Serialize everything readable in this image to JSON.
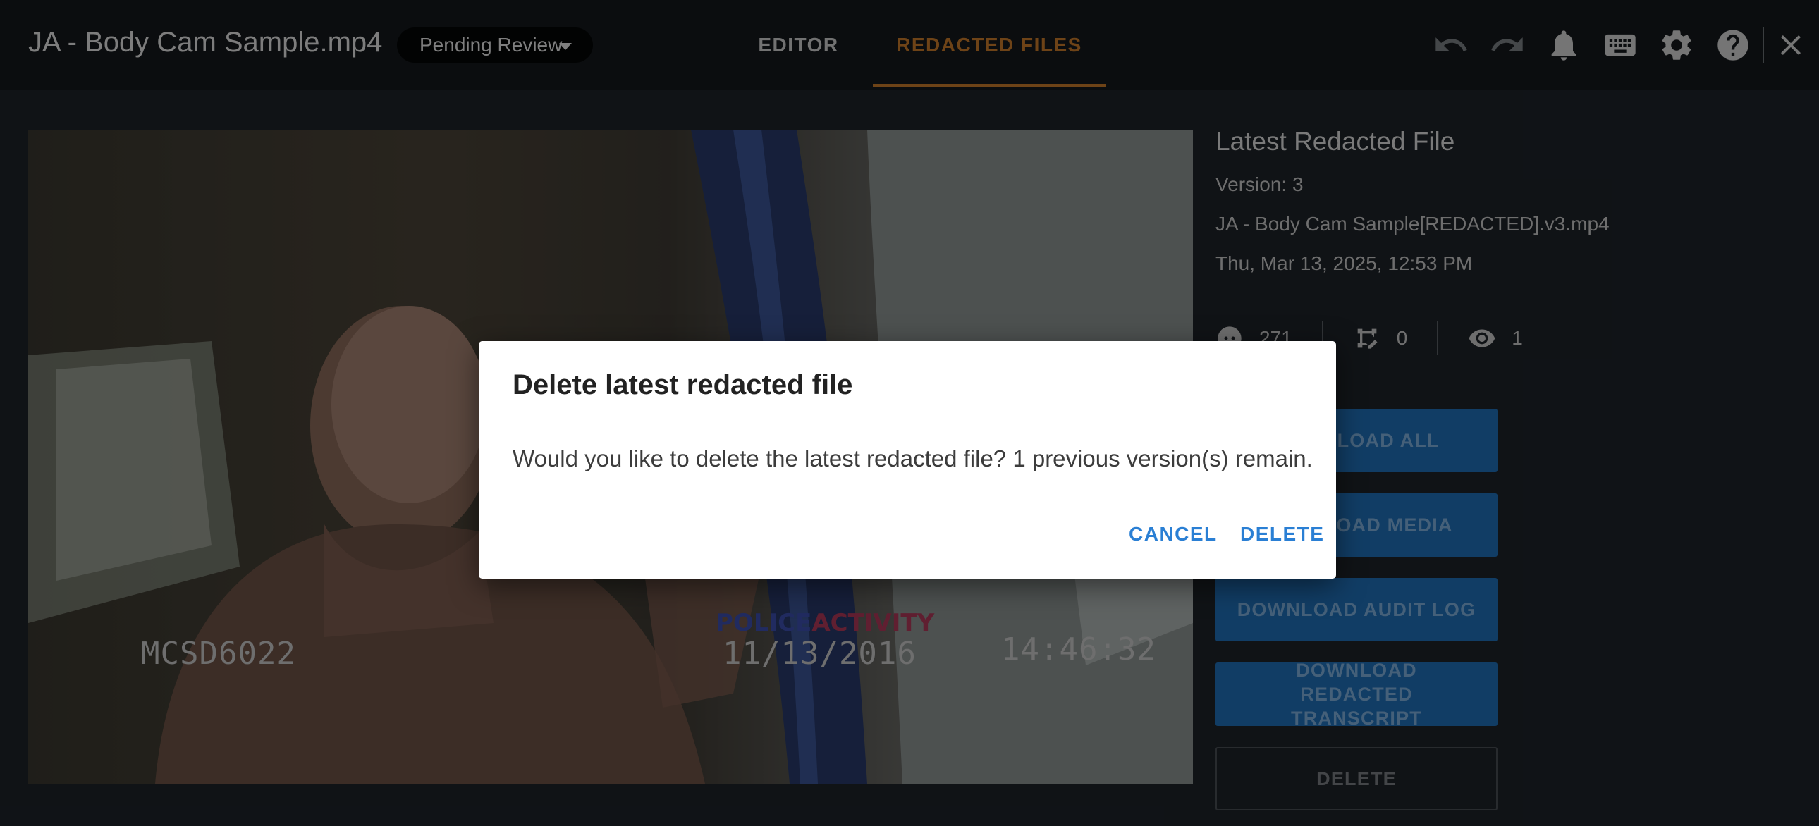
{
  "header": {
    "file_title": "JA - Body Cam Sample.mp4",
    "status": "Pending Review",
    "tabs": [
      {
        "label": "EDITOR",
        "active": false
      },
      {
        "label": "REDACTED FILES",
        "active": true
      }
    ],
    "icons": [
      "undo-icon",
      "redo-icon",
      "bell-icon",
      "keyboard-icon",
      "gear-icon",
      "help-icon",
      "close-icon"
    ]
  },
  "video": {
    "overlay_id": "MCSD6022",
    "overlay_logo_left": "POLICE",
    "overlay_logo_right": "ACTIVITY",
    "overlay_date": "11/13/2016",
    "overlay_time": "14:46:32"
  },
  "panel": {
    "title": "Latest Redacted File",
    "version": "Version: 3",
    "filename": "JA - Body Cam Sample[REDACTED].v3.mp4",
    "date": "Thu, Mar 13, 2025, 12:53 PM",
    "stats": {
      "faces": "271",
      "edits": "0",
      "views": "1"
    },
    "buttons": {
      "download_all": "DOWNLOAD ALL",
      "download_media": "DOWNLOAD MEDIA",
      "download_audit": "DOWNLOAD AUDIT LOG",
      "download_transcript": "DOWNLOAD REDACTED TRANSCRIPT",
      "delete": "DELETE"
    }
  },
  "dialog": {
    "title": "Delete latest redacted file",
    "body": "Would you like to delete the latest redacted file? 1 previous version(s) remain.",
    "cancel": "CANCEL",
    "delete": "DELETE"
  },
  "colors": {
    "accent_tab": "#c97a2a",
    "primary_button": "#1f6fb8",
    "dialog_action": "#2a7fd4"
  }
}
